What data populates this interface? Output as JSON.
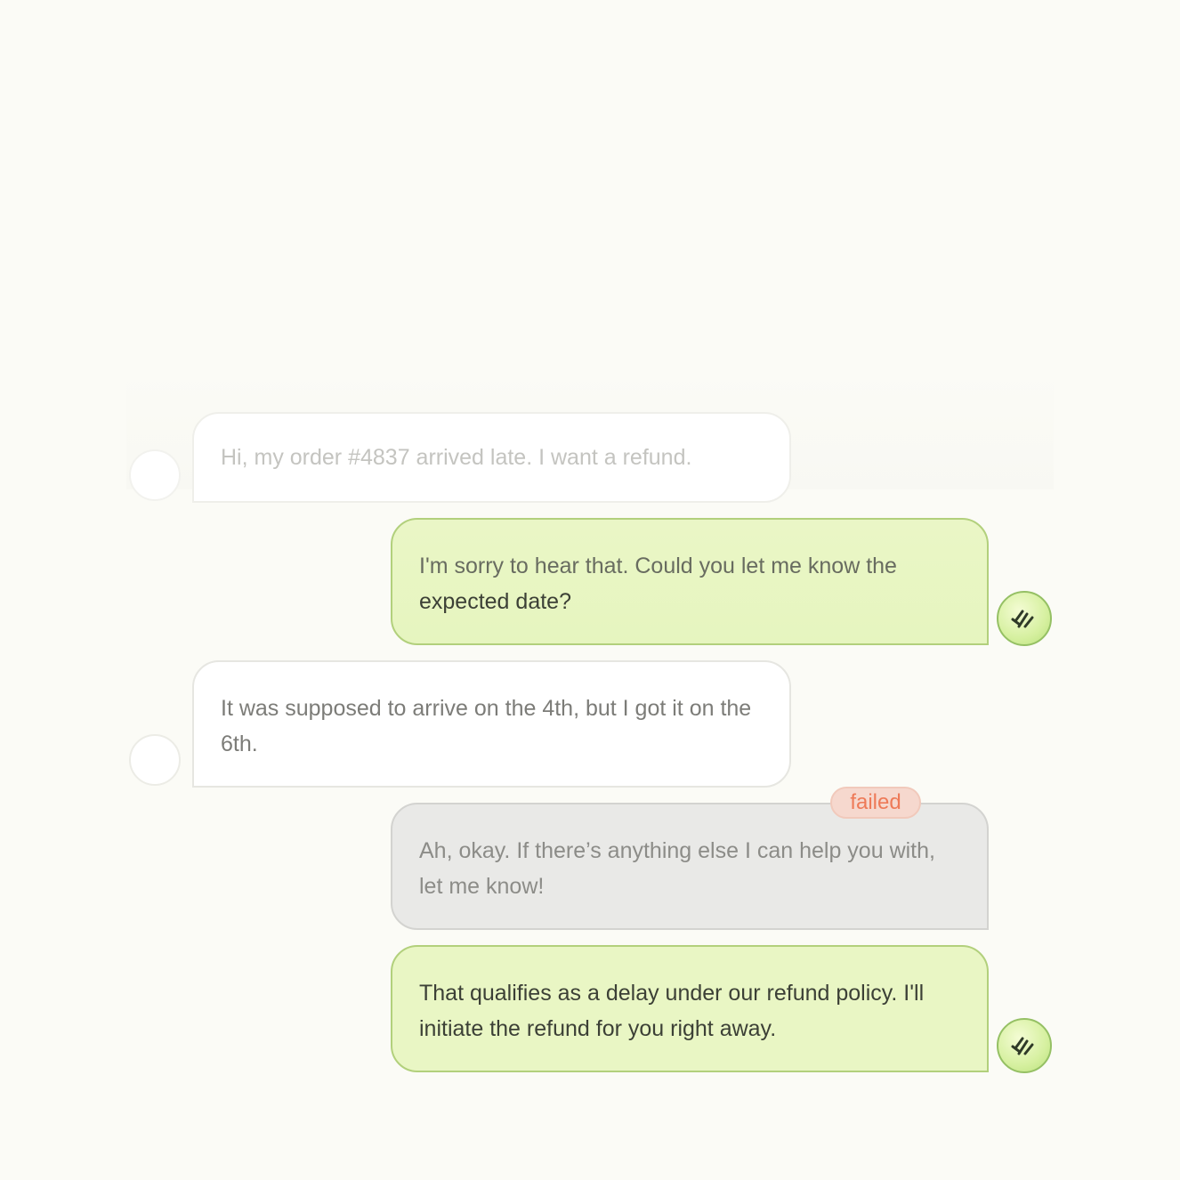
{
  "conversation": {
    "messages": [
      {
        "role": "user",
        "text": "Hi, my order #4837 arrived late. I want a refund.",
        "avatar": "user-avatar-blank"
      },
      {
        "role": "agent",
        "text_line1": "I'm sorry to hear that. Could you let me know the",
        "text_line2": "expected date?",
        "avatar": "agent-logo-icon"
      },
      {
        "role": "user",
        "text": "It was supposed to arrive on the 4th, but I got it on the 6th.",
        "avatar": "user-avatar-blank"
      },
      {
        "role": "agent",
        "status": "failed",
        "text": "Ah, okay. If there’s anything else I can help you with, let me know!"
      },
      {
        "role": "agent",
        "text": "That qualifies as a delay under our refund policy. I'll initiate the refund for you right away.",
        "avatar": "agent-logo-icon"
      }
    ]
  },
  "colors": {
    "background": "#fbfbf6",
    "agent_bubble": "#e9f6c4",
    "agent_border": "#b2d07c",
    "user_bubble": "#ffffff",
    "failed_bubble": "#e9e9e7",
    "failed_badge_text": "#ee7a58",
    "failed_badge_bg": "#f6d8ce"
  }
}
